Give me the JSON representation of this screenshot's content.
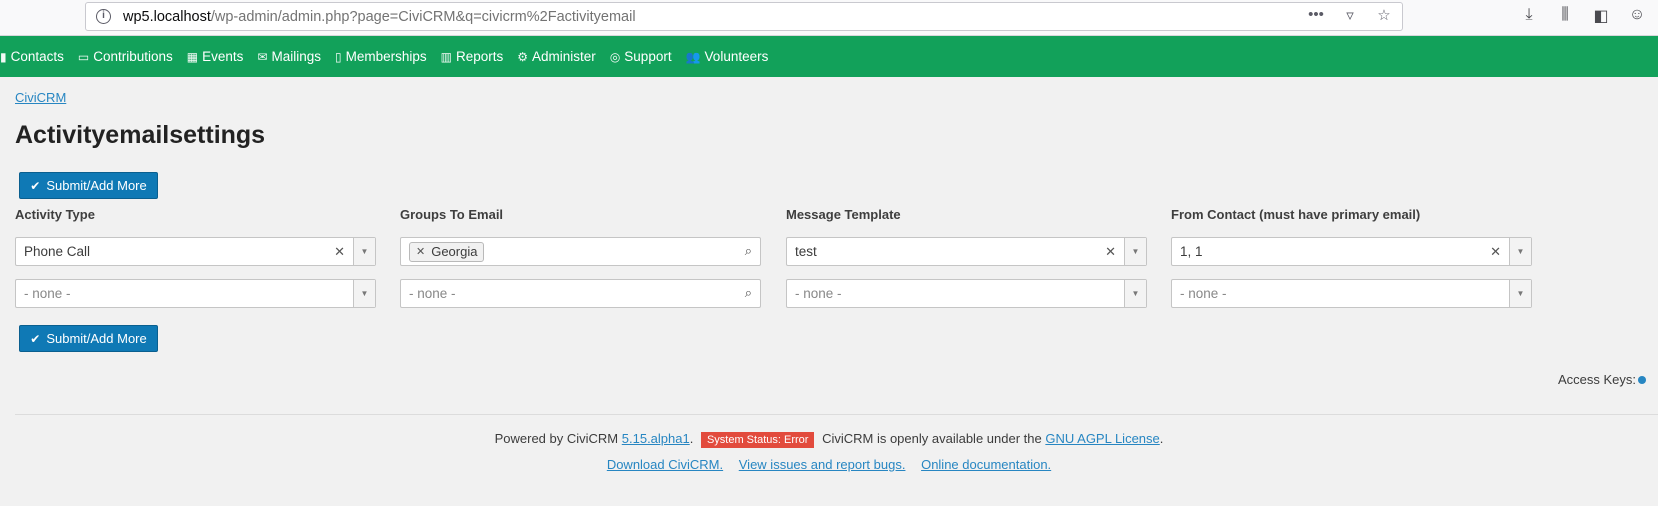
{
  "browser": {
    "url_host": "wp5.localhost",
    "url_path": "/wp-admin/admin.php?page=CiviCRM&q=civicrm%2Factivityemail"
  },
  "nav": {
    "items": [
      {
        "label": "Contacts",
        "icon": "contacts-icon",
        "glyph": "▮"
      },
      {
        "label": "Contributions",
        "icon": "credit-card-icon",
        "glyph": "▭"
      },
      {
        "label": "Events",
        "icon": "calendar-icon",
        "glyph": "▦"
      },
      {
        "label": "Mailings",
        "icon": "envelope-icon",
        "glyph": "✉"
      },
      {
        "label": "Memberships",
        "icon": "id-card-icon",
        "glyph": "▯"
      },
      {
        "label": "Reports",
        "icon": "bar-chart-icon",
        "glyph": "▥"
      },
      {
        "label": "Administer",
        "icon": "gears-icon",
        "glyph": "⚙"
      },
      {
        "label": "Support",
        "icon": "life-ring-icon",
        "glyph": "◎"
      },
      {
        "label": "Volunteers",
        "icon": "users-icon",
        "glyph": "👥"
      }
    ]
  },
  "breadcrumb": "CiviCRM",
  "title": "Activityemailsettings",
  "submit_label": "Submit/Add More",
  "columns": {
    "activity_type": "Activity Type",
    "groups": "Groups To Email",
    "template": "Message Template",
    "from_contact": "From Contact (must have primary email)"
  },
  "row1": {
    "activity_type": "Phone Call",
    "group_tag": "Georgia",
    "template": "test",
    "from_contact": "1, 1"
  },
  "row2": {
    "placeholder": "- none -"
  },
  "access_keys": "Access Keys:",
  "footer": {
    "powered_by": "Powered by CiviCRM",
    "version": "5.15.alpha1",
    "status": "System Status: Error",
    "license_text": "CiviCRM is openly available under the",
    "license_link": "GNU AGPL License",
    "download": "Download CiviCRM.",
    "issues": "View issues and report bugs.",
    "docs": "Online documentation."
  },
  "colors": {
    "nav_bg": "#12a15a",
    "button_bg": "#0f79b5",
    "link": "#2786c2",
    "error": "#e24b3d"
  }
}
